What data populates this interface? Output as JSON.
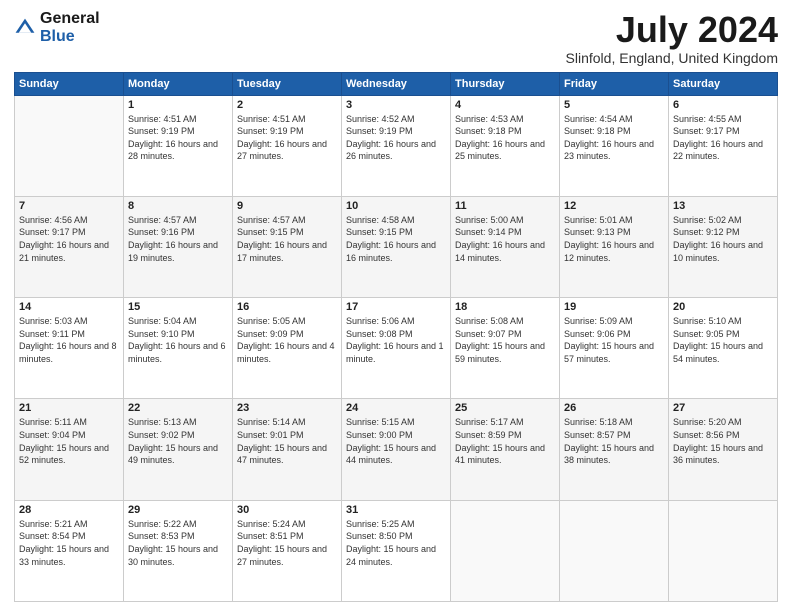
{
  "logo": {
    "general": "General",
    "blue": "Blue"
  },
  "header": {
    "month": "July 2024",
    "location": "Slinfold, England, United Kingdom"
  },
  "weekdays": [
    "Sunday",
    "Monday",
    "Tuesday",
    "Wednesday",
    "Thursday",
    "Friday",
    "Saturday"
  ],
  "weeks": [
    [
      {
        "day": "",
        "empty": true
      },
      {
        "day": "1",
        "sunrise": "4:51 AM",
        "sunset": "9:19 PM",
        "daylight": "16 hours and 28 minutes."
      },
      {
        "day": "2",
        "sunrise": "4:51 AM",
        "sunset": "9:19 PM",
        "daylight": "16 hours and 27 minutes."
      },
      {
        "day": "3",
        "sunrise": "4:52 AM",
        "sunset": "9:19 PM",
        "daylight": "16 hours and 26 minutes."
      },
      {
        "day": "4",
        "sunrise": "4:53 AM",
        "sunset": "9:18 PM",
        "daylight": "16 hours and 25 minutes."
      },
      {
        "day": "5",
        "sunrise": "4:54 AM",
        "sunset": "9:18 PM",
        "daylight": "16 hours and 23 minutes."
      },
      {
        "day": "6",
        "sunrise": "4:55 AM",
        "sunset": "9:17 PM",
        "daylight": "16 hours and 22 minutes."
      }
    ],
    [
      {
        "day": "7",
        "sunrise": "4:56 AM",
        "sunset": "9:17 PM",
        "daylight": "16 hours and 21 minutes."
      },
      {
        "day": "8",
        "sunrise": "4:57 AM",
        "sunset": "9:16 PM",
        "daylight": "16 hours and 19 minutes."
      },
      {
        "day": "9",
        "sunrise": "4:57 AM",
        "sunset": "9:15 PM",
        "daylight": "16 hours and 17 minutes."
      },
      {
        "day": "10",
        "sunrise": "4:58 AM",
        "sunset": "9:15 PM",
        "daylight": "16 hours and 16 minutes."
      },
      {
        "day": "11",
        "sunrise": "5:00 AM",
        "sunset": "9:14 PM",
        "daylight": "16 hours and 14 minutes."
      },
      {
        "day": "12",
        "sunrise": "5:01 AM",
        "sunset": "9:13 PM",
        "daylight": "16 hours and 12 minutes."
      },
      {
        "day": "13",
        "sunrise": "5:02 AM",
        "sunset": "9:12 PM",
        "daylight": "16 hours and 10 minutes."
      }
    ],
    [
      {
        "day": "14",
        "sunrise": "5:03 AM",
        "sunset": "9:11 PM",
        "daylight": "16 hours and 8 minutes."
      },
      {
        "day": "15",
        "sunrise": "5:04 AM",
        "sunset": "9:10 PM",
        "daylight": "16 hours and 6 minutes."
      },
      {
        "day": "16",
        "sunrise": "5:05 AM",
        "sunset": "9:09 PM",
        "daylight": "16 hours and 4 minutes."
      },
      {
        "day": "17",
        "sunrise": "5:06 AM",
        "sunset": "9:08 PM",
        "daylight": "16 hours and 1 minute."
      },
      {
        "day": "18",
        "sunrise": "5:08 AM",
        "sunset": "9:07 PM",
        "daylight": "15 hours and 59 minutes."
      },
      {
        "day": "19",
        "sunrise": "5:09 AM",
        "sunset": "9:06 PM",
        "daylight": "15 hours and 57 minutes."
      },
      {
        "day": "20",
        "sunrise": "5:10 AM",
        "sunset": "9:05 PM",
        "daylight": "15 hours and 54 minutes."
      }
    ],
    [
      {
        "day": "21",
        "sunrise": "5:11 AM",
        "sunset": "9:04 PM",
        "daylight": "15 hours and 52 minutes."
      },
      {
        "day": "22",
        "sunrise": "5:13 AM",
        "sunset": "9:02 PM",
        "daylight": "15 hours and 49 minutes."
      },
      {
        "day": "23",
        "sunrise": "5:14 AM",
        "sunset": "9:01 PM",
        "daylight": "15 hours and 47 minutes."
      },
      {
        "day": "24",
        "sunrise": "5:15 AM",
        "sunset": "9:00 PM",
        "daylight": "15 hours and 44 minutes."
      },
      {
        "day": "25",
        "sunrise": "5:17 AM",
        "sunset": "8:59 PM",
        "daylight": "15 hours and 41 minutes."
      },
      {
        "day": "26",
        "sunrise": "5:18 AM",
        "sunset": "8:57 PM",
        "daylight": "15 hours and 38 minutes."
      },
      {
        "day": "27",
        "sunrise": "5:20 AM",
        "sunset": "8:56 PM",
        "daylight": "15 hours and 36 minutes."
      }
    ],
    [
      {
        "day": "28",
        "sunrise": "5:21 AM",
        "sunset": "8:54 PM",
        "daylight": "15 hours and 33 minutes."
      },
      {
        "day": "29",
        "sunrise": "5:22 AM",
        "sunset": "8:53 PM",
        "daylight": "15 hours and 30 minutes."
      },
      {
        "day": "30",
        "sunrise": "5:24 AM",
        "sunset": "8:51 PM",
        "daylight": "15 hours and 27 minutes."
      },
      {
        "day": "31",
        "sunrise": "5:25 AM",
        "sunset": "8:50 PM",
        "daylight": "15 hours and 24 minutes."
      },
      {
        "day": "",
        "empty": true
      },
      {
        "day": "",
        "empty": true
      },
      {
        "day": "",
        "empty": true
      }
    ]
  ],
  "labels": {
    "sunrise": "Sunrise:",
    "sunset": "Sunset:",
    "daylight": "Daylight:"
  }
}
